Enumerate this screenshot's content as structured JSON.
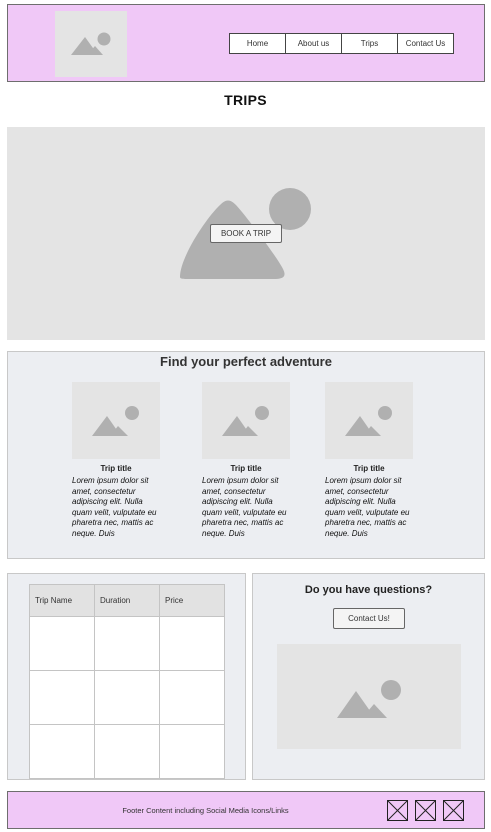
{
  "header": {
    "logo_icon": "image-placeholder-icon",
    "nav": [
      {
        "label": "Home"
      },
      {
        "label": "About us"
      },
      {
        "label": "Trips"
      },
      {
        "label": "Contact Us"
      }
    ]
  },
  "page_title": "TRIPS",
  "hero": {
    "image_icon": "image-placeholder-icon",
    "book_button": "BOOK A TRIP"
  },
  "adventures": {
    "heading": "Find your perfect adventure",
    "cards": [
      {
        "title": "Trip title",
        "description": "Lorem ipsum dolor sit amet, consectetur adipiscing elit. Nulla quam velit, vulputate eu pharetra nec, mattis ac neque. Duis"
      },
      {
        "title": "Trip title",
        "description": "Lorem ipsum dolor sit amet, consectetur adipiscing elit. Nulla quam velit, vulputate eu pharetra nec, mattis ac neque. Duis"
      },
      {
        "title": "Trip title",
        "description": "Lorem ipsum dolor sit amet, consectetur adipiscing elit. Nulla quam velit, vulputate eu pharetra nec, mattis ac neque. Duis"
      }
    ]
  },
  "trips_table": {
    "columns": [
      "Trip Name",
      "Duration",
      "Price"
    ],
    "rows": [
      [
        "",
        "",
        ""
      ],
      [
        "",
        "",
        ""
      ],
      [
        "",
        "",
        ""
      ]
    ]
  },
  "questions": {
    "heading": "Do you have questions?",
    "contact_button": "Contact Us!",
    "image_icon": "image-placeholder-icon"
  },
  "footer": {
    "text": "Footer Content including Social Media Icons/Links",
    "social_icons": [
      "social-icon-placeholder",
      "social-icon-placeholder",
      "social-icon-placeholder"
    ]
  },
  "colors": {
    "header_bg": "#f0c8f7",
    "footer_bg": "#f0c8f7",
    "panel_bg": "#eceef2",
    "placeholder_bg": "#e4e4e4",
    "placeholder_shape": "#b0b0b0"
  }
}
